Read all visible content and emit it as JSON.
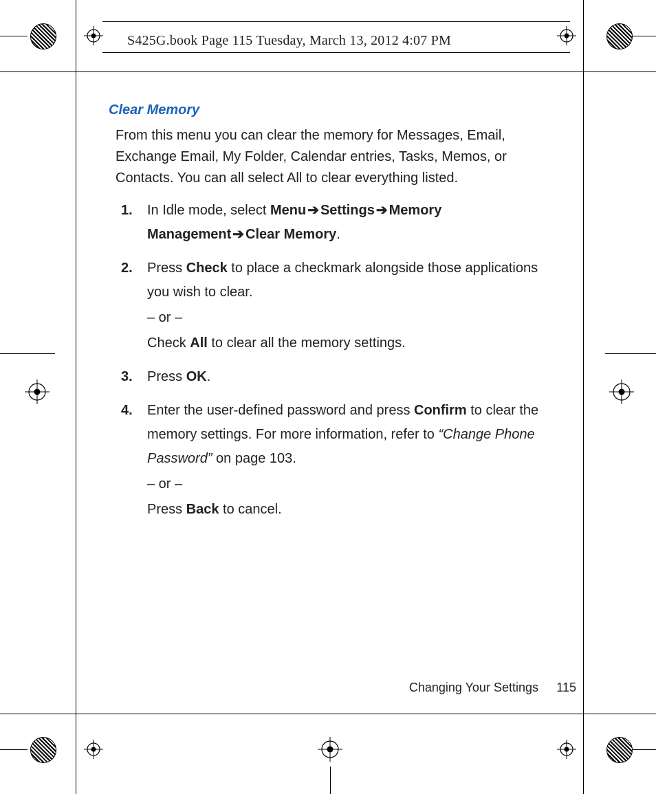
{
  "slug": "S425G.book  Page 115  Tuesday, March 13, 2012  4:07 PM",
  "section_title": "Clear Memory",
  "intro": "From this menu you can clear the memory for Messages, Email, Exchange Email, My Folder, Calendar entries, Tasks, Memos, or Contacts. You can all select All to clear everything listed.",
  "steps": {
    "s1_a": "In Idle mode, select ",
    "s1_menu": "Menu",
    "s1_settings": "Settings",
    "s1_mm": "Memory Management",
    "s1_cm": "Clear Memory",
    "s1_period": ".",
    "s2_a": "Press ",
    "s2_check": "Check",
    "s2_b": " to place a checkmark alongside those applications you wish to clear.",
    "s2_or": "– or –",
    "s2_c": "Check ",
    "s2_all": "All",
    "s2_d": " to clear all the memory settings.",
    "s3_a": "Press ",
    "s3_ok": "OK",
    "s3_period": ".",
    "s4_a": "Enter the user-defined password and press ",
    "s4_confirm": "Confirm",
    "s4_b": " to clear the memory settings. For more information, refer to ",
    "s4_ref": "“Change Phone Password” ",
    "s4_c": " on page 103.",
    "s4_or": "– or –",
    "s4_d": "Press ",
    "s4_back": "Back",
    "s4_e": " to cancel."
  },
  "arrow": "➔",
  "footer_label": "Changing Your Settings",
  "footer_page": "115"
}
